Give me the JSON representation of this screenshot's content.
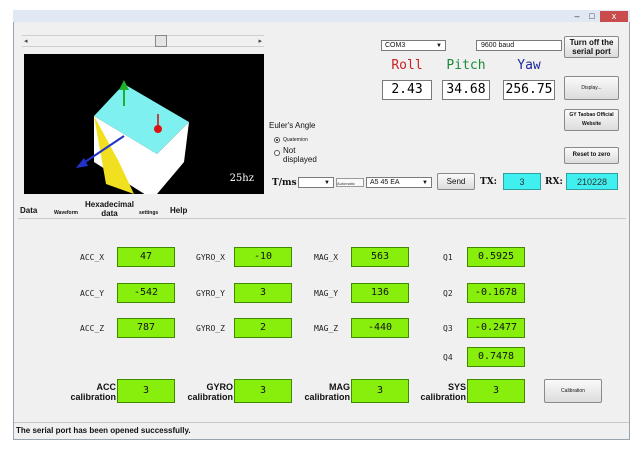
{
  "window": {
    "controls": {
      "minimize": "–",
      "maximize": "□",
      "close": "x"
    }
  },
  "slider": {
    "left_arrow": "◂",
    "right_arrow": "▸"
  },
  "viewport": {
    "fps": "25hz"
  },
  "serial": {
    "port": "COM3",
    "baud": "9600 baud",
    "close_button": "Turn off the serial port"
  },
  "angles": {
    "roll": {
      "label": "Roll",
      "value": "2.43",
      "color": "#cc2222"
    },
    "pitch": {
      "label": "Pitch",
      "value": "34.68",
      "color": "#1a8a3a"
    },
    "yaw": {
      "label": "Yaw",
      "value": "256.75",
      "color": "#1a2a9a"
    }
  },
  "right_buttons": {
    "display": "Display...",
    "website": "GY Taobao Official Website",
    "reset": "Reset to zero"
  },
  "euler": {
    "title": "Euler's Angle",
    "option_quaternion": "Quaternion",
    "option_not_displayed": "Not displayed"
  },
  "send_row": {
    "tms_label": "T/ms",
    "automatic_label": "Automatic",
    "hex_value": "A5 45 EA",
    "send_button": "Send",
    "tx_label": "TX:",
    "tx_value": "3",
    "rx_label": "RX:",
    "rx_value": "210228"
  },
  "tabs": [
    {
      "label": "Data"
    },
    {
      "label": "Waveform"
    },
    {
      "label": "Hexadecimal data"
    },
    {
      "label": "settings"
    },
    {
      "label": "Help"
    }
  ],
  "readings": {
    "acc_x": {
      "label": "ACC_X",
      "value": "47"
    },
    "acc_y": {
      "label": "ACC_Y",
      "value": "-542"
    },
    "acc_z": {
      "label": "ACC_Z",
      "value": "787"
    },
    "gyro_x": {
      "label": "GYRO_X",
      "value": "-10"
    },
    "gyro_y": {
      "label": "GYRO_Y",
      "value": "3"
    },
    "gyro_z": {
      "label": "GYRO_Z",
      "value": "2"
    },
    "mag_x": {
      "label": "MAG_X",
      "value": "563"
    },
    "mag_y": {
      "label": "MAG_Y",
      "value": "136"
    },
    "mag_z": {
      "label": "MAG_Z",
      "value": "-440"
    },
    "q1": {
      "label": "Q1",
      "value": "0.5925"
    },
    "q2": {
      "label": "Q2",
      "value": "-0.1678"
    },
    "q3": {
      "label": "Q3",
      "value": "-0.2477"
    },
    "q4": {
      "label": "Q4",
      "value": "0.7478"
    }
  },
  "calibration": {
    "acc": {
      "label": "ACC calibration",
      "value": "3"
    },
    "gyro": {
      "label": "GYRO calibration",
      "value": "3"
    },
    "mag": {
      "label": "MAG calibration",
      "value": "3"
    },
    "sys": {
      "label": "SYS calibration",
      "value": "3"
    },
    "button": "Calibration"
  },
  "status": {
    "text": "The serial port has been opened successfully."
  }
}
